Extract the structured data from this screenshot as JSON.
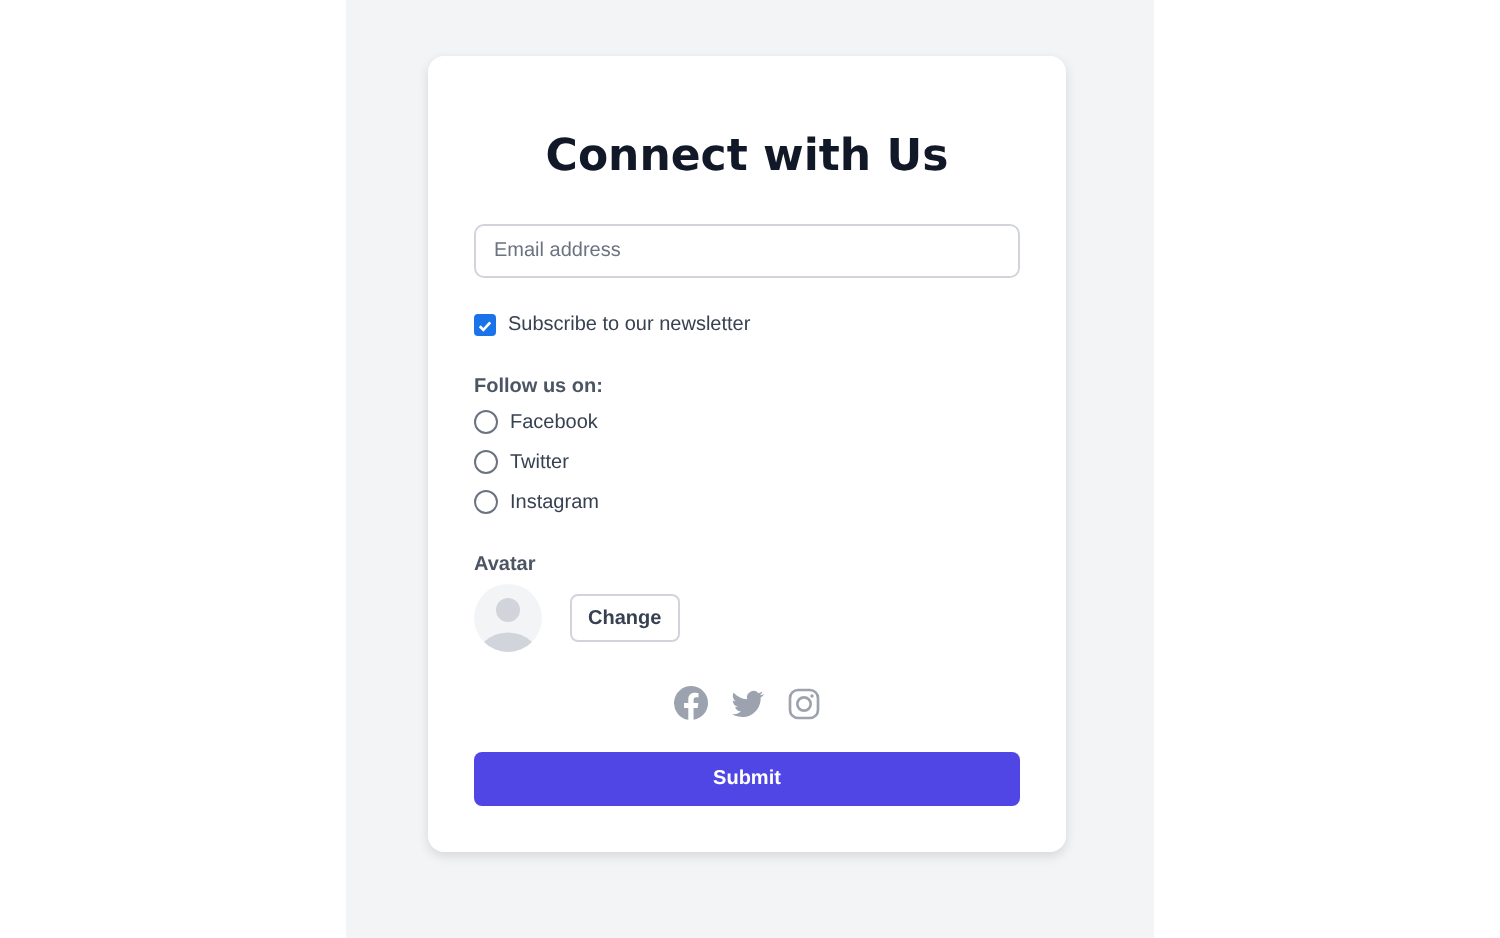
{
  "title": "Connect with Us",
  "email": {
    "placeholder": "Email address"
  },
  "newsletter": {
    "label": "Subscribe to our newsletter",
    "checked": true
  },
  "follow": {
    "label": "Follow us on:",
    "options": [
      {
        "label": "Facebook",
        "selected": false
      },
      {
        "label": "Twitter",
        "selected": false
      },
      {
        "label": "Instagram",
        "selected": false
      }
    ]
  },
  "avatar": {
    "label": "Avatar",
    "button": "Change"
  },
  "submit": "Submit"
}
